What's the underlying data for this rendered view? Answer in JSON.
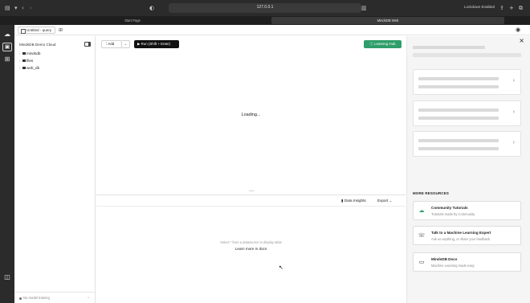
{
  "browser": {
    "url": "127.0.0.1",
    "lockdown": "Lockdown Enabled",
    "tabs": [
      {
        "label": "Start Page",
        "active": false
      },
      {
        "label": "MindsDB Web",
        "active": true
      }
    ]
  },
  "app": {
    "query_tab": "Untitled - query",
    "sidebar": {
      "title": "MindsDB Demo Cloud",
      "tree": [
        {
          "label": "mindsdb",
          "icon": "folder-icon"
        },
        {
          "label": "files",
          "icon": "folder-icon"
        },
        {
          "label": "web_db",
          "icon": "database-icon"
        }
      ],
      "footer": "No model training"
    },
    "editor": {
      "add_label": "Add",
      "run_label": "Run (Shift + Enter)",
      "learning_hub_label": "Learning Hub",
      "loading_text": "Loading..."
    },
    "results": {
      "data_insights_label": "Data Insights",
      "export_label": "Export",
      "hint": "Select * from a datasource to display table",
      "link": "Learn more in docs"
    },
    "right_panel": {
      "section_title": "MORE RESOURCES",
      "resources": [
        {
          "title": "Community Tutorials",
          "subtitle": "Tutorials made by Community",
          "icon": "tutorial-icon"
        },
        {
          "title": "Talk to a Machine Learning Expert",
          "subtitle": "Ask us anything, or share your feedback",
          "icon": "support-icon"
        },
        {
          "title": "MindsDB Docs",
          "subtitle": "Machine Learning made easy",
          "icon": "book-icon"
        }
      ]
    }
  },
  "colors": {
    "accent_green": "#2f9e6a",
    "run_button": "#111111"
  }
}
